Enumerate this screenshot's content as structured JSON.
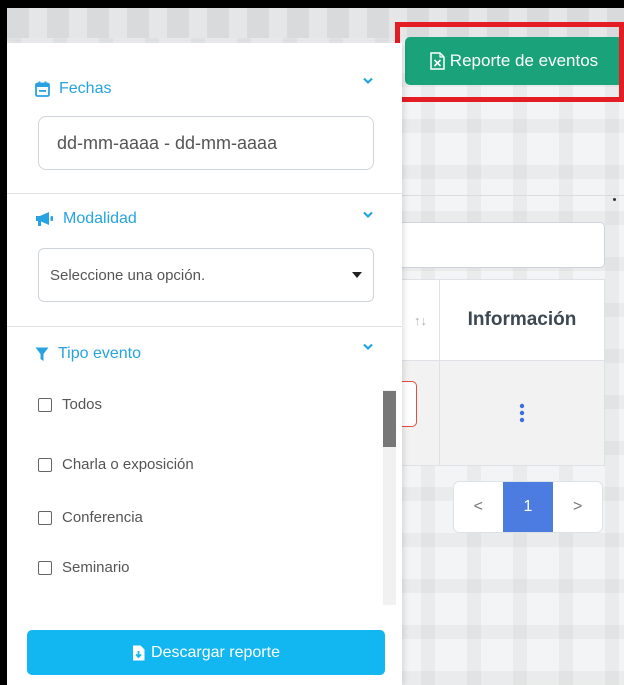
{
  "header": {
    "report_button_label": "Reporte de eventos"
  },
  "filters": {
    "fechas": {
      "title": "Fechas",
      "placeholder": "dd-mm-aaaa - dd-mm-aaaa"
    },
    "modalidad": {
      "title": "Modalidad",
      "selected": "Seleccione una opción."
    },
    "tipo_evento": {
      "title": "Tipo evento",
      "options": [
        "Todos",
        "Charla o exposición",
        "Conferencia",
        "Seminario"
      ]
    },
    "download_label": "Descargar reporte"
  },
  "table": {
    "sort_icon": "↑↓",
    "header_info": "Información"
  },
  "pagination": {
    "prev": "<",
    "current": "1",
    "next": ">"
  },
  "colors": {
    "accent_blue": "#26a3e0",
    "report_green": "#1aa37a",
    "download_blue": "#12b6f0",
    "highlight_red": "#e41c23",
    "page_active": "#4c7ce0"
  },
  "icons": {
    "fechas": "calendar-icon",
    "modalidad": "megaphone-icon",
    "tipo_evento": "filter-icon",
    "report": "excel-file-icon",
    "download": "file-download-icon",
    "info": "kebab-vertical-icon"
  }
}
